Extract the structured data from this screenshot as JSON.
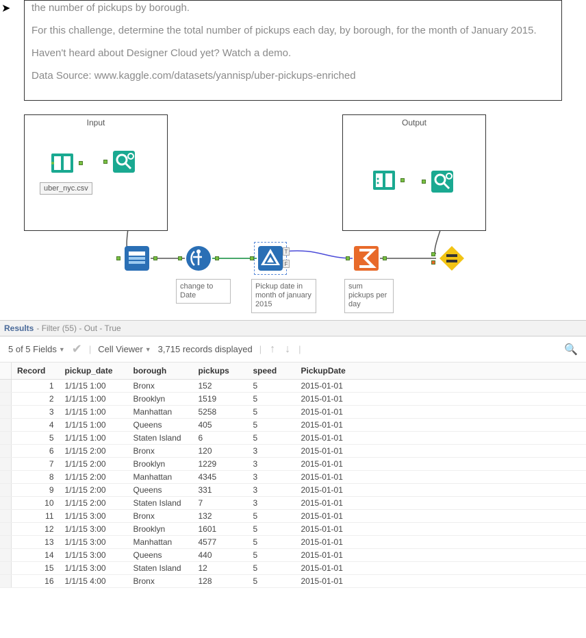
{
  "description": {
    "line0": "the number of pickups by borough.",
    "line1": "For this challenge, determine the total number of pickups each day, by borough, for the month of January 2015.",
    "line2": "Haven't heard about Designer Cloud yet? Watch a demo.",
    "line3": "Data Source: www.kaggle.com/datasets/yannisp/uber-pickups-enriched"
  },
  "canvas": {
    "input_label": "Input",
    "output_label": "Output",
    "file_name": "uber_nyc.csv",
    "anno_formula": "change to Date",
    "anno_filter": "Pickup date in month of january 2015",
    "anno_summarize": "sum pickups per day"
  },
  "results": {
    "title": "Results",
    "filter_text": "- Filter (55) - Out - True",
    "fields_label": "5 of 5 Fields",
    "cell_viewer": "Cell Viewer",
    "records": "3,715 records displayed"
  },
  "table": {
    "headers": [
      "Record",
      "pickup_date",
      "borough",
      "pickups",
      "speed",
      "PickupDate"
    ],
    "rows": [
      [
        "1",
        "1/1/15 1:00",
        "Bronx",
        "152",
        "5",
        "2015-01-01"
      ],
      [
        "2",
        "1/1/15 1:00",
        "Brooklyn",
        "1519",
        "5",
        "2015-01-01"
      ],
      [
        "3",
        "1/1/15 1:00",
        "Manhattan",
        "5258",
        "5",
        "2015-01-01"
      ],
      [
        "4",
        "1/1/15 1:00",
        "Queens",
        "405",
        "5",
        "2015-01-01"
      ],
      [
        "5",
        "1/1/15 1:00",
        "Staten Island",
        "6",
        "5",
        "2015-01-01"
      ],
      [
        "6",
        "1/1/15 2:00",
        "Bronx",
        "120",
        "3",
        "2015-01-01"
      ],
      [
        "7",
        "1/1/15 2:00",
        "Brooklyn",
        "1229",
        "3",
        "2015-01-01"
      ],
      [
        "8",
        "1/1/15 2:00",
        "Manhattan",
        "4345",
        "3",
        "2015-01-01"
      ],
      [
        "9",
        "1/1/15 2:00",
        "Queens",
        "331",
        "3",
        "2015-01-01"
      ],
      [
        "10",
        "1/1/15 2:00",
        "Staten Island",
        "7",
        "3",
        "2015-01-01"
      ],
      [
        "11",
        "1/1/15 3:00",
        "Bronx",
        "132",
        "5",
        "2015-01-01"
      ],
      [
        "12",
        "1/1/15 3:00",
        "Brooklyn",
        "1601",
        "5",
        "2015-01-01"
      ],
      [
        "13",
        "1/1/15 3:00",
        "Manhattan",
        "4577",
        "5",
        "2015-01-01"
      ],
      [
        "14",
        "1/1/15 3:00",
        "Queens",
        "440",
        "5",
        "2015-01-01"
      ],
      [
        "15",
        "1/1/15 3:00",
        "Staten Island",
        "12",
        "5",
        "2015-01-01"
      ],
      [
        "16",
        "1/1/15 4:00",
        "Bronx",
        "128",
        "5",
        "2015-01-01"
      ]
    ]
  }
}
